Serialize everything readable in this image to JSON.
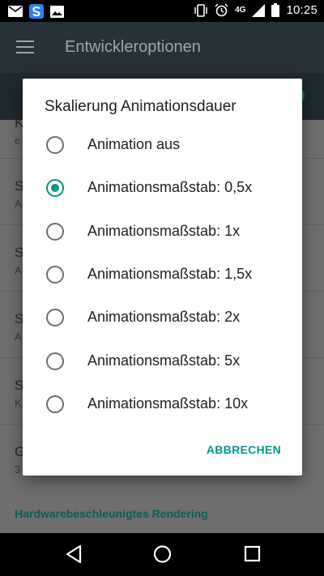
{
  "status_bar": {
    "left_icons": [
      "mail-icon",
      "sync-app-icon",
      "image-icon"
    ],
    "right_icons": [
      "vibrate-icon",
      "alarm-icon",
      "signal-icon",
      "battery-icon"
    ],
    "network": "4G",
    "time": "10:25"
  },
  "app_bar": {
    "title": "Entwickleroptionen",
    "menu_icon": "hamburger-menu-icon"
  },
  "background_rows": [
    {
      "title": "K",
      "subtitle": "e"
    },
    {
      "title": "S",
      "subtitle": "A"
    },
    {
      "title": "S",
      "subtitle": "A"
    },
    {
      "title": "S",
      "subtitle": "A"
    },
    {
      "title": "S",
      "subtitle": "K"
    },
    {
      "title": "G",
      "subtitle": "3"
    }
  ],
  "background_section": "Hardwarebeschleunigtes Rendering",
  "dialog": {
    "title": "Skalierung Animationsdauer",
    "options": [
      {
        "label": "Animation aus",
        "selected": false
      },
      {
        "label": "Animationsmaßstab: 0,5x",
        "selected": true
      },
      {
        "label": "Animationsmaßstab: 1x",
        "selected": false
      },
      {
        "label": "Animationsmaßstab: 1,5x",
        "selected": false
      },
      {
        "label": "Animationsmaßstab: 2x",
        "selected": false
      },
      {
        "label": "Animationsmaßstab: 5x",
        "selected": false
      },
      {
        "label": "Animationsmaßstab: 10x",
        "selected": false
      }
    ],
    "cancel_label": "ABBRECHEN"
  },
  "nav_bar": {
    "buttons": [
      "back-icon",
      "home-icon",
      "recents-icon"
    ]
  },
  "colors": {
    "accent": "#009688",
    "app_bar": "#263238",
    "status_bar": "#000000"
  }
}
